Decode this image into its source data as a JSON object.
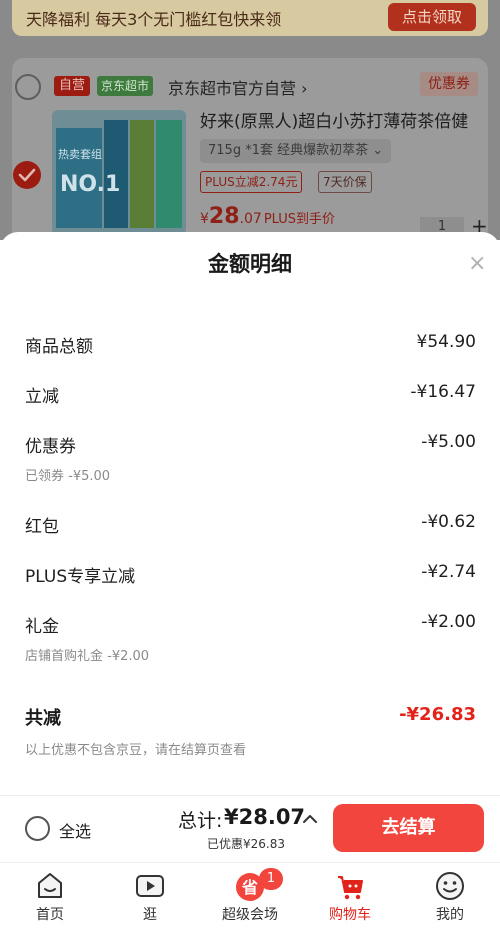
{
  "banner": {
    "text": "天降福利 每天3个无门槛红包快来领",
    "button": "点击领取"
  },
  "cart_item": {
    "self_tag": "自营",
    "jd_tag": "京东超市",
    "store_name": "京东超市官方自营 ›",
    "coupon_tag": "优惠券",
    "product_title": "好来(原黑人)超白小苏打薄荷茶倍健",
    "spec": "715g *1套 经典爆款初萃茶 ⌄",
    "plus_tag": "PLUS立减2.74元",
    "price_guarantee_tag": "7天价保",
    "price_symbol": "¥",
    "price_int": "28",
    "price_dec": ".07",
    "price_note": "PLUS到手价",
    "quantity": "1",
    "qty_plus": "+",
    "thumb_text_1": "热卖套组",
    "thumb_text_2": "NO.1"
  },
  "detail": {
    "title": "金额明细",
    "close": "×",
    "rows": [
      {
        "label": "商品总额",
        "value": "¥54.90",
        "sub": ""
      },
      {
        "label": "立减",
        "value": "-¥16.47",
        "sub": ""
      },
      {
        "label": "优惠券",
        "value": "-¥5.00",
        "sub": "已领券 -¥5.00"
      },
      {
        "label": "红包",
        "value": "-¥0.62",
        "sub": ""
      },
      {
        "label": "PLUS专享立减",
        "value": "-¥2.74",
        "sub": ""
      },
      {
        "label": "礼金",
        "value": "-¥2.00",
        "sub": "店铺首购礼金 -¥2.00"
      }
    ],
    "total_label": "共减",
    "total_value": "-¥26.83",
    "footnote": "以上优惠不包含京豆，请在结算页查看"
  },
  "checkout": {
    "select_all": "全选",
    "sum_label": "总计:",
    "sum_value": "¥28.07",
    "saved": "已优惠¥26.83",
    "pay_button": "去结算"
  },
  "tabs": [
    {
      "label": "首页",
      "icon": "home-icon"
    },
    {
      "label": "逛",
      "icon": "video-play-icon"
    },
    {
      "label": "超级会场",
      "icon": "save-money-icon"
    },
    {
      "label": "购物车",
      "icon": "cart-icon"
    },
    {
      "label": "我的",
      "icon": "profile-face-icon"
    }
  ],
  "badge": "1",
  "colors": {
    "accent": "#e2231a",
    "button": "#f2453d",
    "overlay": "#8a8a8a"
  }
}
